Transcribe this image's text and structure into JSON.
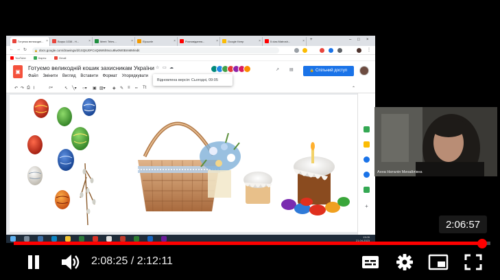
{
  "browser": {
    "tabs": [
      {
        "label": "Готуємо великодні...",
        "color": "#e8453c",
        "active": true
      },
      {
        "label": "Boqso 1038 - Н...",
        "color": "#e8453c"
      },
      {
        "label": "Meet: Teles...",
        "color": "#1e8e3e"
      },
      {
        "label": "Elpuzzle",
        "color": "#f29900"
      },
      {
        "label": "Розповідання...",
        "color": "#ff0000"
      },
      {
        "label": "Google Keep",
        "color": "#fbbc04"
      },
      {
        "label": "5 clas Matrosh...",
        "color": "#ff0000"
      }
    ],
    "url": "docs.google.com/drawings/d/1SQ6J0FCnQ6W6h9xcu9lw0W0BmMM/edit",
    "bookmarks": [
      {
        "label": "YouTube",
        "color": "#ff0000"
      },
      {
        "label": "Карты",
        "color": "#34a853"
      },
      {
        "label": "Gmail",
        "color": "#ea4335"
      }
    ]
  },
  "doc": {
    "title": "Готуємо великодній кошик захисникам України",
    "menu": [
      "Файл",
      "Змінити",
      "Вигляд",
      "Вставити",
      "Формат",
      "Упорядкувати"
    ],
    "share_label": "Спільний доступ",
    "restore_tooltip": "Відновлена версія: Сьогодні, 09:05"
  },
  "taskbar": {
    "time": "13:05",
    "date": "21.04.2023"
  },
  "webcam": {
    "name": "Анна Наталія Михайлівна"
  },
  "player": {
    "seek_tooltip": "2:06:57",
    "current_time": "2:08:25",
    "duration": "2:12:11",
    "progress": 0.9834,
    "accent": "#ff0000"
  }
}
